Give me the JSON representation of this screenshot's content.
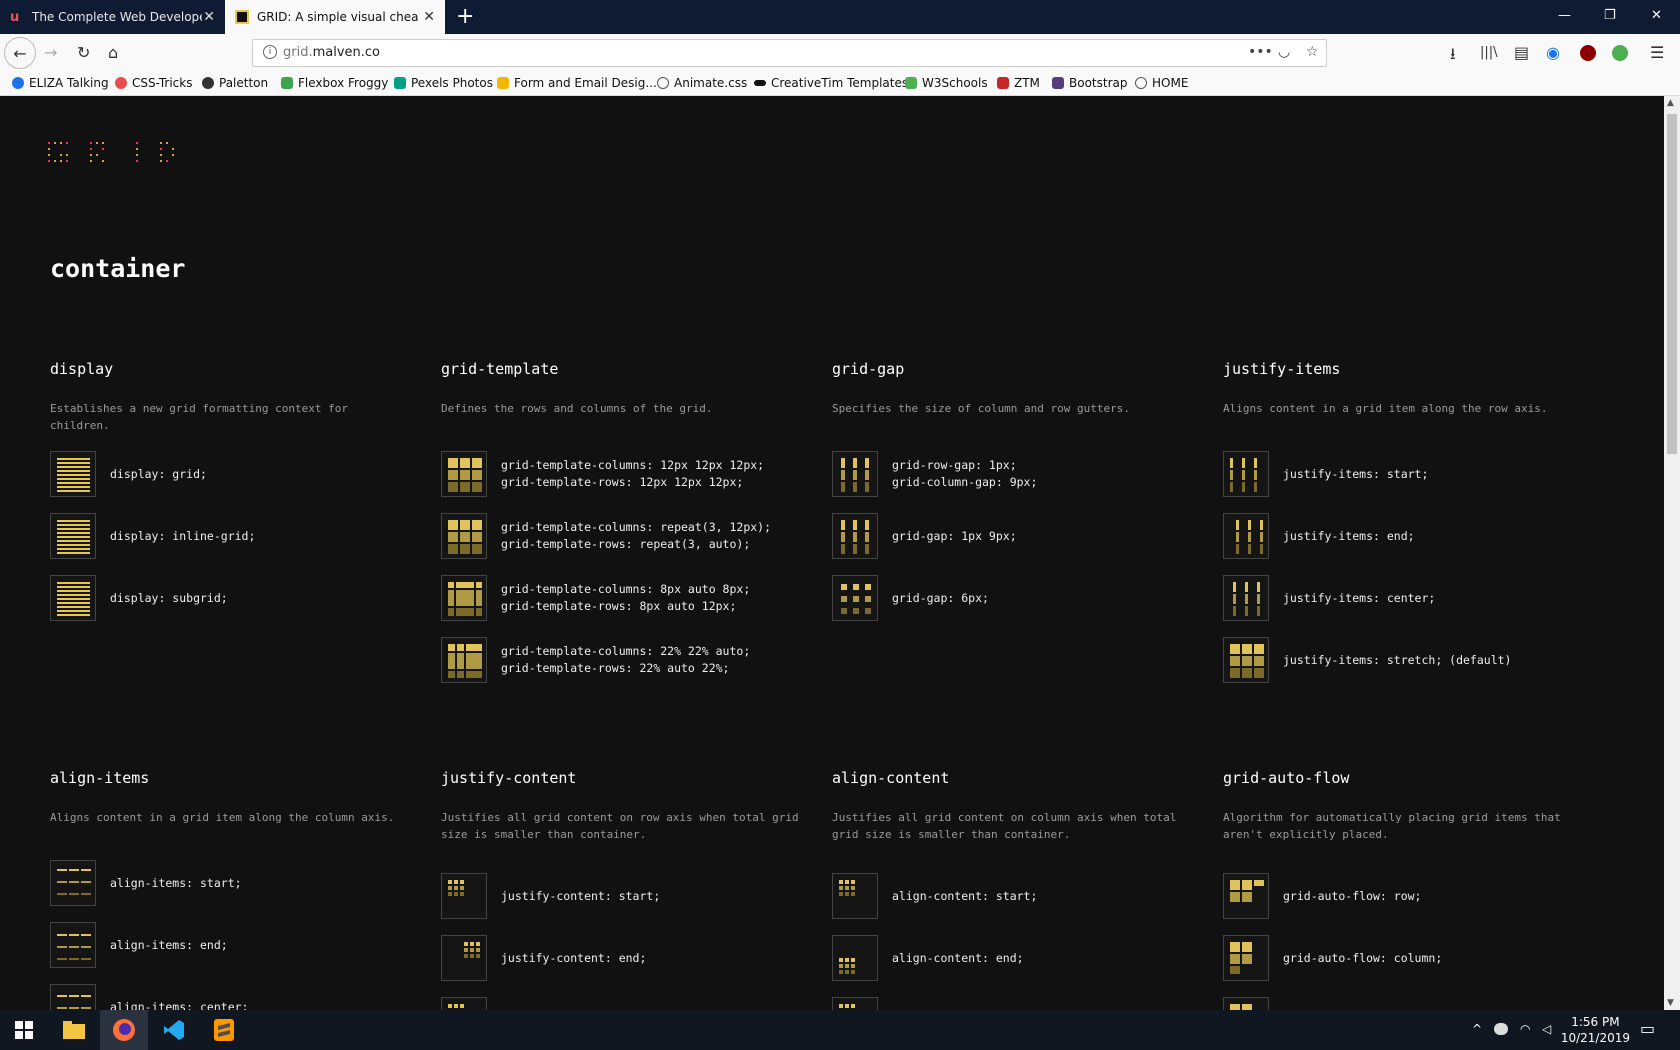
{
  "tabs": [
    {
      "title": "The Complete Web Developer i",
      "close": "✕"
    },
    {
      "title": "GRID: A simple visual cheatsheet",
      "close": "✕"
    }
  ],
  "new_tab": "+",
  "window_controls": {
    "minimize": "—",
    "restore": "❐",
    "close": "✕"
  },
  "nav": {
    "back": "←",
    "forward": "→",
    "reload": "↻",
    "home": "⌂"
  },
  "url": {
    "host_prefix": "grid.",
    "host": "malven.co",
    "more": "•••",
    "pocket": "◡",
    "star": "☆"
  },
  "toolbar_icons": {
    "download": "⭳",
    "library": "|||\\",
    "sidebar": "▤",
    "sync": "◉",
    "menu": "☰"
  },
  "bookmarks": [
    {
      "label": "ELIZA Talking",
      "color": "#1a73e8"
    },
    {
      "label": "CSS-Tricks",
      "color": "#e94e4e"
    },
    {
      "label": "Paletton",
      "color": "#333333"
    },
    {
      "label": "Flexbox Froggy",
      "color": "#3fa34d"
    },
    {
      "label": "Pexels Photos",
      "color": "#05a081"
    },
    {
      "label": "Form and Email Desig...",
      "color": "#f2b705"
    },
    {
      "label": "Animate.css",
      "color": "#555555"
    },
    {
      "label": "CreativeTim Templates",
      "color": "#111111"
    },
    {
      "label": "W3Schools",
      "color": "#4caf50"
    },
    {
      "label": "ZTM",
      "color": "#c62828"
    },
    {
      "label": "Bootstrap",
      "color": "#563d7c"
    },
    {
      "label": "HOME",
      "color": "#555555"
    }
  ],
  "page": {
    "section_title": "container",
    "properties": [
      {
        "name": "display",
        "desc": "Establishes a new grid formatting context for children.",
        "items": [
          {
            "code": "display: grid;"
          },
          {
            "code": "display: inline-grid;"
          },
          {
            "code": "display: subgrid;"
          }
        ]
      },
      {
        "name": "grid-template",
        "desc": "Defines the rows and columns of the grid.",
        "items": [
          {
            "code": "grid-template-columns: 12px 12px 12px;\ngrid-template-rows: 12px 12px 12px;"
          },
          {
            "code": "grid-template-columns: repeat(3, 12px);\ngrid-template-rows: repeat(3, auto);"
          },
          {
            "code": "grid-template-columns: 8px auto 8px;\ngrid-template-rows: 8px auto 12px;"
          },
          {
            "code": "grid-template-columns: 22% 22% auto;\ngrid-template-rows: 22% auto 22%;"
          }
        ]
      },
      {
        "name": "grid-gap",
        "desc": "Specifies the size of column and row gutters.",
        "items": [
          {
            "code": "grid-row-gap: 1px;\ngrid-column-gap: 9px;"
          },
          {
            "code": "grid-gap: 1px 9px;"
          },
          {
            "code": "grid-gap: 6px;"
          }
        ]
      },
      {
        "name": "justify-items",
        "desc": "Aligns content in a grid item along the row axis.",
        "items": [
          {
            "code": "justify-items: start;"
          },
          {
            "code": "justify-items: end;"
          },
          {
            "code": "justify-items: center;"
          },
          {
            "code": "justify-items: stretch; (default)"
          }
        ]
      },
      {
        "name": "align-items",
        "desc": "Aligns content in a grid item along the column axis.",
        "items": [
          {
            "code": "align-items: start;"
          },
          {
            "code": "align-items: end;"
          },
          {
            "code": "align-items: center;"
          }
        ]
      },
      {
        "name": "justify-content",
        "desc": "Justifies all grid content on row axis when total grid size is smaller than container.",
        "items": [
          {
            "code": "justify-content: start;"
          },
          {
            "code": "justify-content: end;"
          },
          {
            "code": ""
          }
        ]
      },
      {
        "name": "align-content",
        "desc": "Justifies all grid content on column axis when total grid size is smaller than container.",
        "items": [
          {
            "code": "align-content: start;"
          },
          {
            "code": "align-content: end;"
          },
          {
            "code": ""
          }
        ]
      },
      {
        "name": "grid-auto-flow",
        "desc": "Algorithm for automatically placing grid items that aren't explicitly placed.",
        "items": [
          {
            "code": "grid-auto-flow: row;"
          },
          {
            "code": "grid-auto-flow: column;"
          },
          {
            "code": ""
          }
        ]
      }
    ]
  },
  "taskbar": {
    "apps": [
      "windows-start",
      "file-explorer",
      "firefox",
      "vscode",
      "sublime-text"
    ],
    "tray": {
      "chevron": "^",
      "network": "◠",
      "volume": "◁"
    },
    "time": "1:56 PM",
    "date": "10/21/2019",
    "notifications": "▭"
  },
  "accent_color": "#e8c84b"
}
